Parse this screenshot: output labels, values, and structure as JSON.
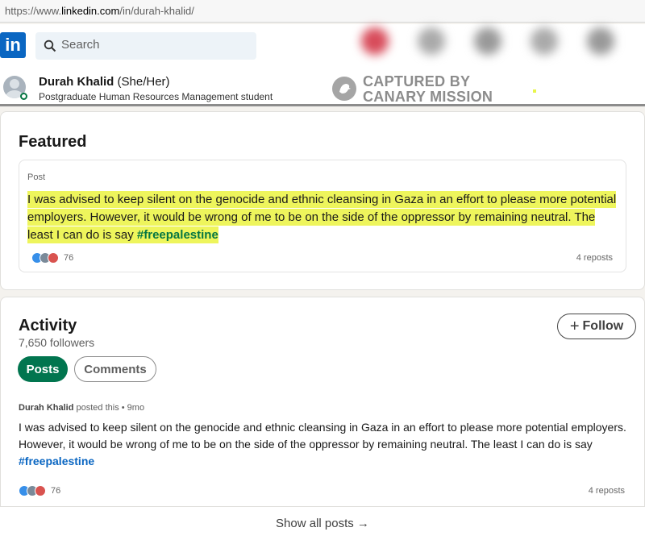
{
  "url": {
    "prefix": "https://www.",
    "domain": "linkedin.com",
    "path": "/in/durah-khalid/"
  },
  "nav": {
    "logo": "in",
    "search_placeholder": "Search"
  },
  "profile": {
    "name": "Durah Khalid",
    "pronouns": "(She/Her)",
    "headline": "Postgraduate Human Resources Management student"
  },
  "watermark": {
    "line1": "CAPTURED BY",
    "line2": "CANARY MISSION"
  },
  "featured": {
    "title": "Featured",
    "post_label": "Post",
    "text": "I was advised to keep silent on the genocide and ethnic cleansing in Gaza in an effort to please more potential employers. However, it would be wrong of me to be on the side of the oppressor by remaining neutral. The least I can do is say ",
    "hashtag": "#freepalestine",
    "reactions": "76",
    "reposts": "4 reposts"
  },
  "activity": {
    "title": "Activity",
    "followers": "7,650 followers",
    "follow_label": "Follow",
    "tabs": [
      "Posts",
      "Comments"
    ],
    "author": "Durah Khalid",
    "meta": " posted this • 9mo",
    "text": "I was advised to keep silent on the genocide and ethnic cleansing in Gaza in an effort to please more potential employers. However, it would be wrong of me to be on the side of the oppressor by remaining neutral. The least I can do is say ",
    "hashtag": "#freepalestine",
    "reactions": "76",
    "reposts": "4 reposts",
    "show_all": "Show all posts →"
  },
  "colors": {
    "linkedin_blue": "#0a66c2",
    "green": "#01754f",
    "highlight": "#eef55c"
  }
}
